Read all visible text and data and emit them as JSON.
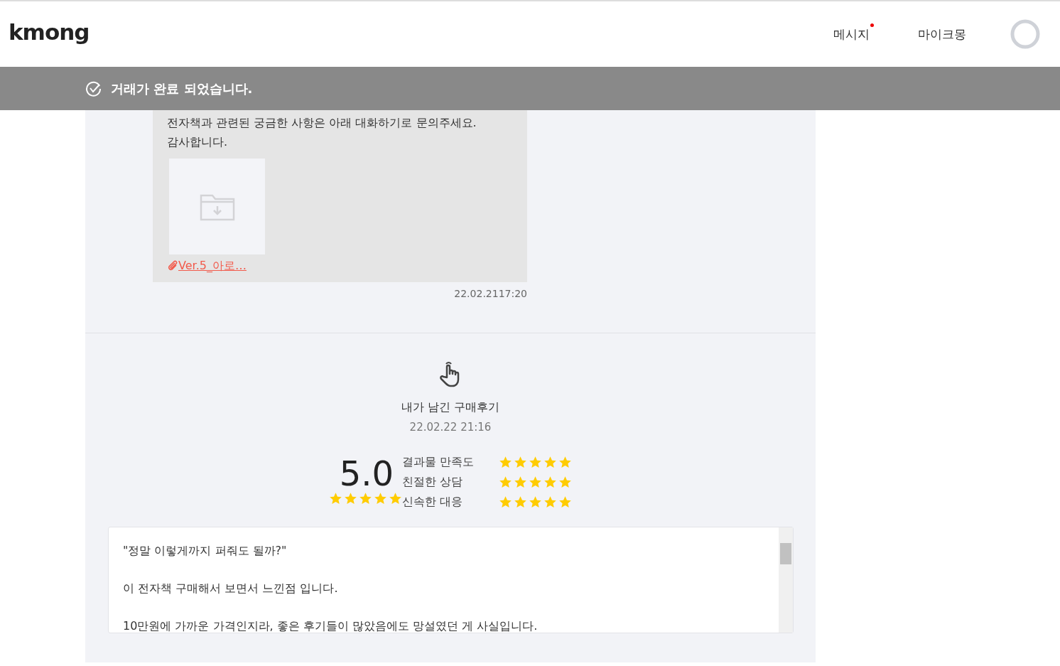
{
  "header": {
    "logo": "kmong",
    "nav": [
      {
        "label": "메시지",
        "unread": true
      },
      {
        "label": "마이크몽",
        "unread": false
      }
    ]
  },
  "banner": {
    "text": "거래가 완료 되었습니다."
  },
  "message": {
    "lines": [
      "전자책과 관련된 궁금한 사항은 아래 대화하기로 문의주세요.",
      "감사합니다."
    ],
    "attachment": "Ver.5_아로…",
    "time": "22.02.2117:20"
  },
  "review": {
    "title": "내가 남긴 구매후기",
    "date": "22.02.22 21:16",
    "score": "5.0",
    "stars": 5,
    "categories": [
      {
        "label": "결과물 만족도",
        "stars": 5
      },
      {
        "label": "친절한 상담",
        "stars": 5
      },
      {
        "label": "신속한 대응",
        "stars": 5
      }
    ],
    "text": [
      "\"정말 이렇게까지 퍼줘도 될까?\"",
      "이 전자책 구매해서 보면서 느낀점 입니다.",
      "10만원에 가까운 가격인지라, 좋은 후기들이 많았음에도 망설였던 게 사실입니다."
    ]
  }
}
